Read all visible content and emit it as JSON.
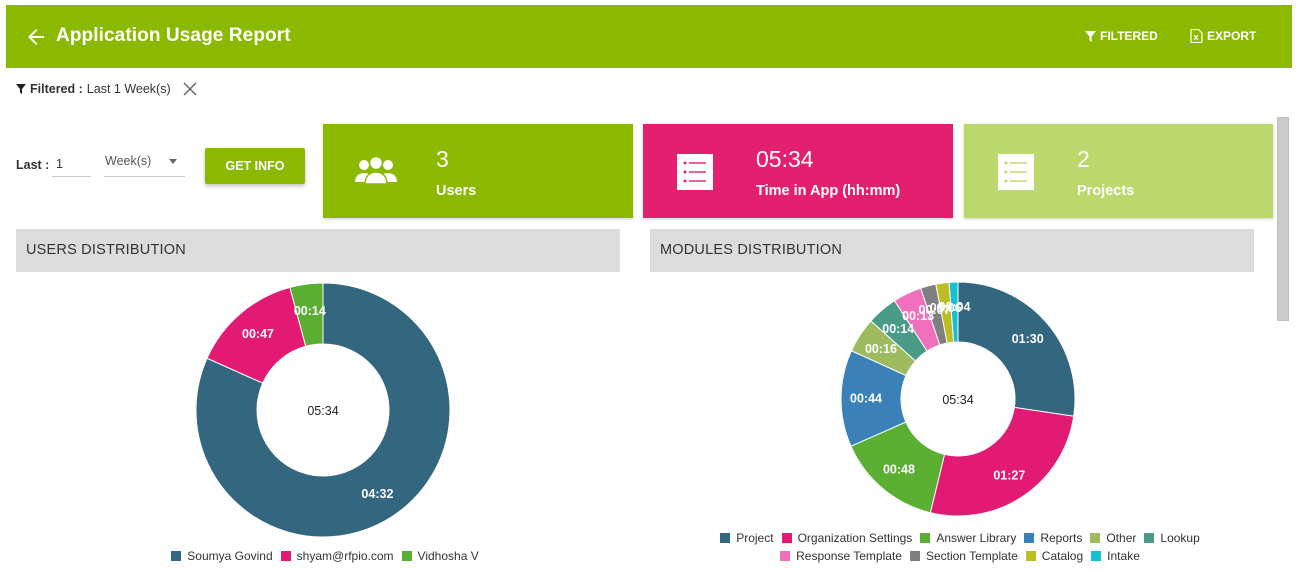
{
  "header": {
    "title": "Application Usage Report",
    "back_icon": "arrow-left-icon",
    "filtered_label": "FILTERED",
    "filtered_icon": "funnel-icon",
    "export_label": "EXPORT",
    "export_icon": "excel-file-icon",
    "background": "#8bb900"
  },
  "filter_summary": {
    "label": "Filtered :",
    "value": "Last 1 Week(s)",
    "clear_icon": "close-icon"
  },
  "controls": {
    "last_label": "Last :",
    "amount_value": "1",
    "unit_selected": "Week(s)",
    "get_info_label": "GET INFO"
  },
  "cards": [
    {
      "value": "3",
      "label": "Users",
      "icon": "users-icon",
      "color": "#8bb900"
    },
    {
      "value": "05:34",
      "label": "Time in App (hh:mm)",
      "icon": "list-icon",
      "color": "#e3206f"
    },
    {
      "value": "2",
      "label": "Projects",
      "icon": "list-icon",
      "color": "#bbd86c"
    }
  ],
  "sections": {
    "users": "USERS DISTRIBUTION",
    "modules": "MODULES DISTRIBUTION"
  },
  "chart_data": [
    {
      "type": "pie",
      "subtype": "donut",
      "title": "USERS DISTRIBUTION",
      "center_label": "05:34",
      "legend_position": "bottom",
      "categories": [
        "Soumya Govind",
        "shyam@rfpio.com",
        "Vidhosha V"
      ],
      "values_minutes": [
        272,
        47,
        14
      ],
      "labels": [
        "04:32",
        "00:47",
        "00:14"
      ],
      "colors": [
        "#33667f",
        "#e31a74",
        "#5aae32"
      ]
    },
    {
      "type": "pie",
      "subtype": "donut",
      "title": "MODULES DISTRIBUTION",
      "center_label": "05:34",
      "legend_position": "bottom",
      "categories": [
        "Project",
        "Organization Settings",
        "Answer Library",
        "Reports",
        "Other",
        "Lookup",
        "Response Template",
        "Section Template",
        "Catalog",
        "Intake"
      ],
      "values_minutes": [
        90,
        87,
        48,
        44,
        16,
        14,
        13,
        7,
        6,
        4
      ],
      "labels": [
        "01:30",
        "01:27",
        "00:48",
        "00:44",
        "00:16",
        "00:14",
        "00:13",
        "00:07",
        "00:06",
        "00:04"
      ],
      "colors": [
        "#33667f",
        "#e31a74",
        "#5aae32",
        "#3a81ba",
        "#9cbb5e",
        "#4a9a88",
        "#f070be",
        "#7f7f7f",
        "#bcbd22",
        "#17bfd0"
      ]
    }
  ]
}
